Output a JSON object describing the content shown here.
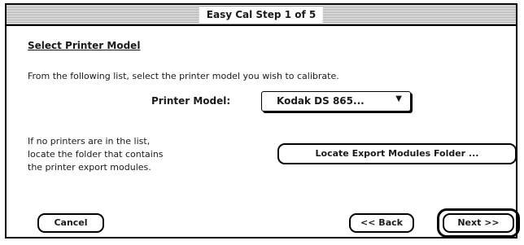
{
  "window": {
    "title": "Easy Cal Step 1 of 5"
  },
  "content": {
    "heading": "Select Printer Model",
    "instruction": "From the following list, select the printer model you wish to calibrate.",
    "printer_model_label": "Printer Model:",
    "printer_model_value": "Kodak DS 865...",
    "popup_arrow_icon": "triangle-down-icon",
    "help_lines": [
      "If no printers are in the list,",
      "locate the folder that contains",
      "the printer export modules."
    ]
  },
  "buttons": {
    "locate": "Locate Export Modules Folder ...",
    "cancel": "Cancel",
    "back": "<< Back",
    "next": "Next >>"
  }
}
